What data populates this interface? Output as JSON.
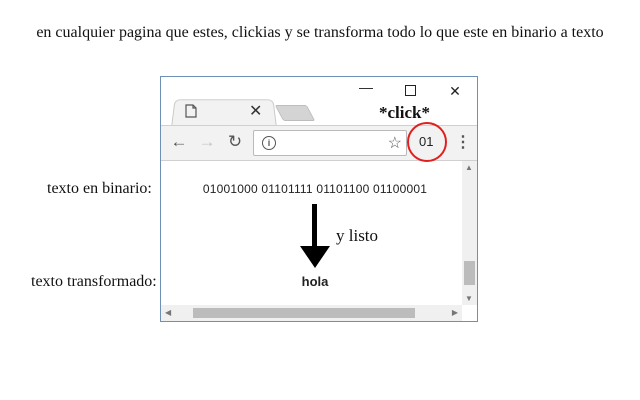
{
  "caption": "en cualquier pagina que estes, clickias y se transforma todo lo que este en binario a texto",
  "labels": {
    "binary": "texto en binario:",
    "transformed": "texto transformado:"
  },
  "browser": {
    "tab_close_glyph": "✕",
    "window_controls": {
      "minimize": "—",
      "close": "✕"
    },
    "toolbar": {
      "back_glyph": "←",
      "forward_glyph": "→",
      "reload_glyph": "↻",
      "info_glyph": "i",
      "star_glyph": "☆",
      "extension_label": "01",
      "menu_glyph": "⋮"
    },
    "content": {
      "binary_text": "01001000 01101111 01101100 01100001",
      "result_text": "hola"
    }
  },
  "annotations": {
    "click_note": "*click*",
    "listo_note": "y listo"
  },
  "colors": {
    "highlight_circle": "#e01f1f",
    "window_border": "#6e8fb6"
  },
  "icons": [
    "page-icon",
    "close-icon",
    "minimize-icon",
    "maximize-icon",
    "back-arrow-icon",
    "forward-arrow-icon",
    "reload-icon",
    "info-icon",
    "star-icon",
    "menu-icon",
    "down-arrow-icon"
  ]
}
